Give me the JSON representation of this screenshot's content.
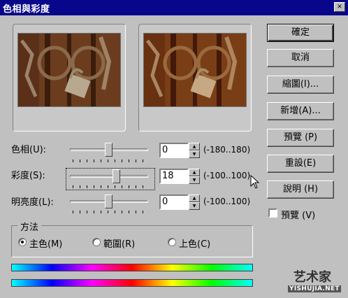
{
  "window": {
    "title": "色相與彩度",
    "close_glyph": "×"
  },
  "buttons": {
    "ok": "確定",
    "cancel": "取消",
    "zoom": "縮圖(I)...",
    "new": "新增(A)...",
    "preview": "預覽 (P)",
    "reset": "重設(E)",
    "help": "說明 (H)"
  },
  "adjustments": {
    "hue": {
      "label": "色相(U):",
      "value": "0",
      "range": "(-180..180)",
      "level": 0.5
    },
    "saturation": {
      "label": "彩度(S):",
      "value": "18",
      "range": "(-100..100)",
      "level": 0.59
    },
    "lightness": {
      "label": "明亮度(L):",
      "value": "0",
      "range": "(-100..100)",
      "level": 0.5
    }
  },
  "method": {
    "title": "方法",
    "options": [
      {
        "label": "主色(M)",
        "checked": true
      },
      {
        "label": "範圍(R)",
        "checked": false
      },
      {
        "label": "上色(C)",
        "checked": false
      }
    ]
  },
  "preview_checkbox": {
    "label": "預覽 (V)",
    "checked": false
  },
  "watermark": {
    "logo": "艺术家",
    "url": "YISHUJIA.NET"
  },
  "colors": {
    "title_bar": "#08068a",
    "face": "#c0c0c0"
  }
}
